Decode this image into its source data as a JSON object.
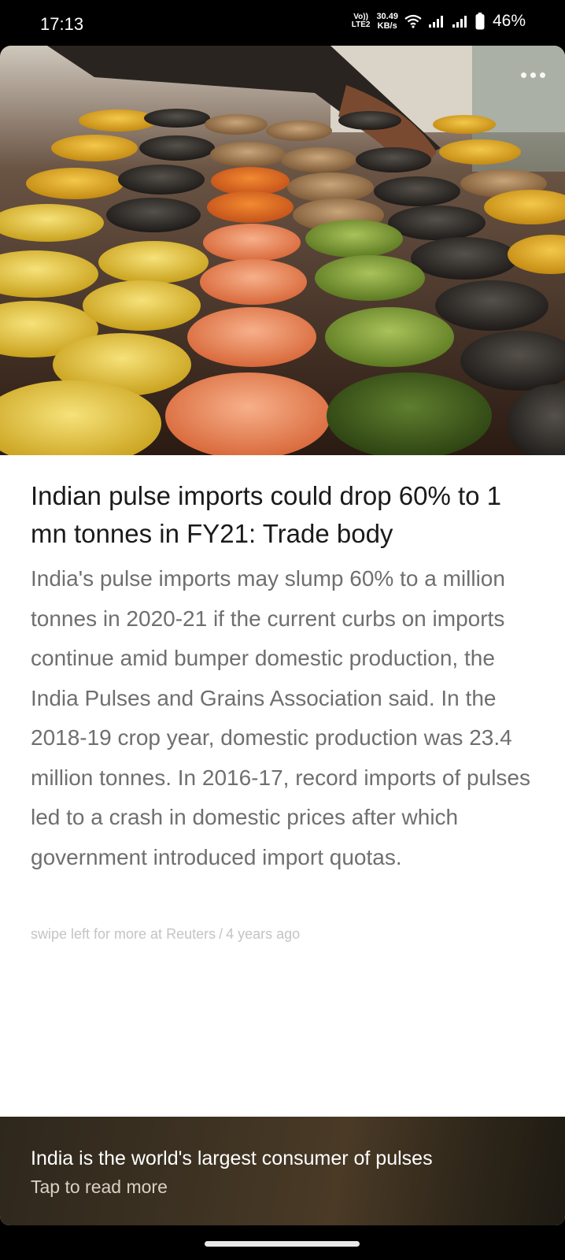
{
  "status_bar": {
    "time": "17:13",
    "volte_top": "Vo))",
    "volte_bottom": "LTE2",
    "speed_value": "30.49",
    "speed_unit": "KB/s",
    "battery": "46%"
  },
  "article": {
    "image_alt": "Bowls of assorted pulses and lentils at a market",
    "headline": "Indian pulse imports could drop 60% to 1 mn tonnes in FY21: Trade body",
    "body": "India's pulse imports may slump 60% to a million tonnes in 2020-21 if the current curbs on imports continue amid bumper domestic production, the India Pulses and Grains Association said. In the 2018-19 crop year, domestic production was 23.4 million tonnes. In 2016-17, record imports of pulses led to a crash in domestic prices after which government introduced import quotas.",
    "meta_swipe": "swipe left for more at Reuters",
    "meta_separator": "/",
    "meta_time": "4 years ago"
  },
  "teaser": {
    "title": "India is the world's largest consumer of pulses",
    "subtitle": "Tap to read more"
  },
  "icons": {
    "more": "more-options-icon",
    "wifi": "wifi-icon",
    "signal": "signal-icon",
    "battery": "battery-icon"
  }
}
